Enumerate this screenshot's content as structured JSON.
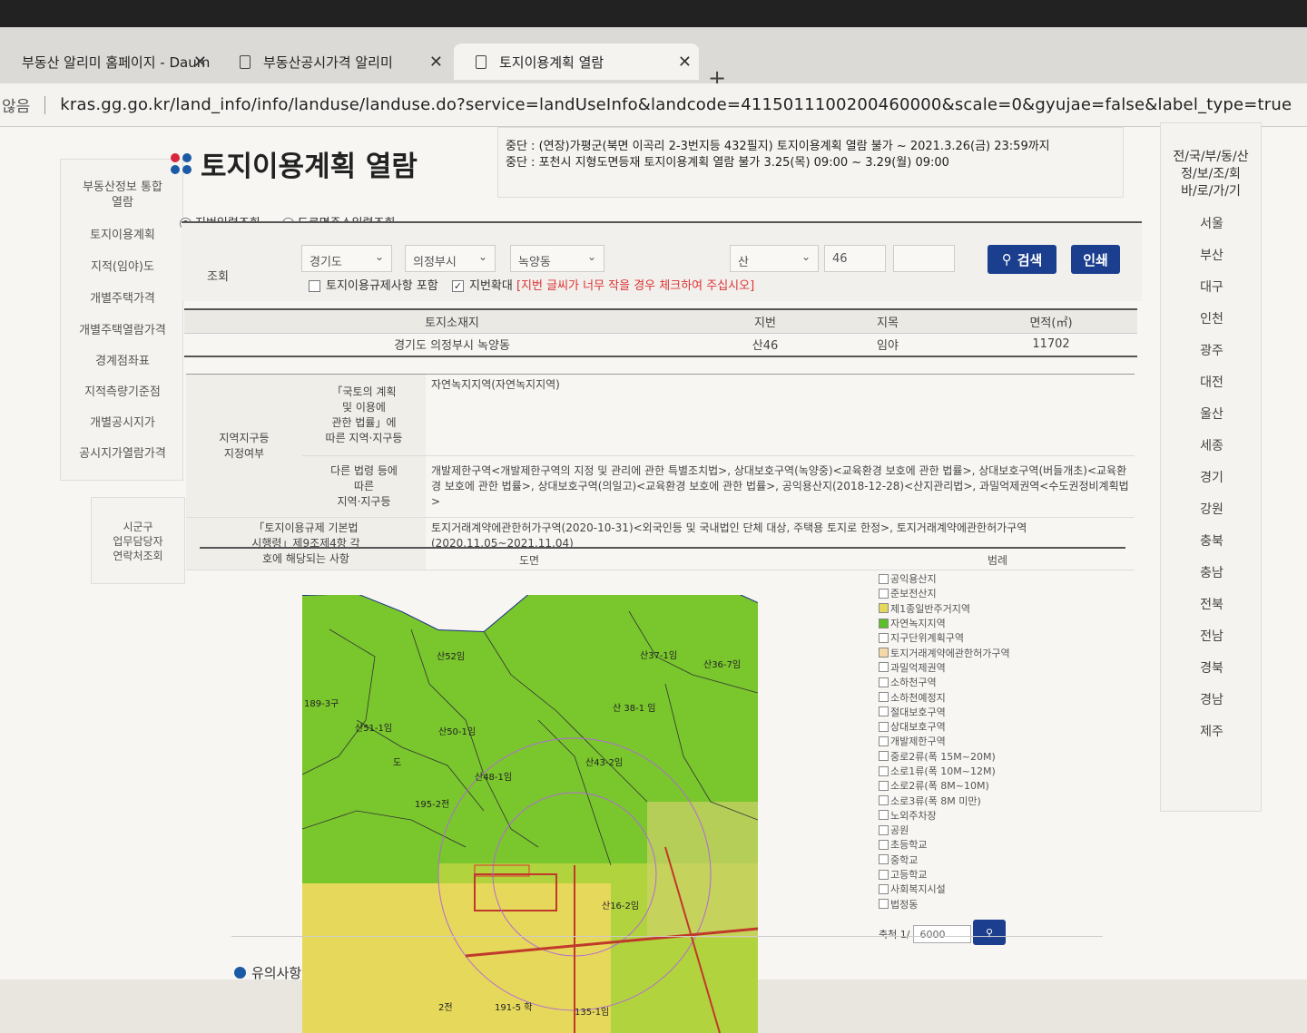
{
  "browser": {
    "tabs": [
      {
        "label": "부동산 알리미 홈페이지 - Daum"
      },
      {
        "label": "부동산공시가격 알리미"
      },
      {
        "label": "토지이용계획 열람"
      }
    ],
    "security": "않음",
    "url": "kras.gg.go.kr/land_info/info/landuse/landuse.do?service=landUseInfo&landcode=4115011100200460000&scale=0&gyujae=false&label_type=true"
  },
  "left_nav": {
    "items": [
      "부동산정보 통합\n열람",
      "토지이용계획",
      "지적(임야)도",
      "개별주택가격",
      "개별주택열람가격",
      "경계점좌표",
      "지적측량기준점",
      "개별공시지가",
      "공시지가열람가격"
    ],
    "contact": "시군구\n업무담당자\n연락처조회"
  },
  "page": {
    "title": "토지이용계획 열람",
    "notice_1": "중단 : (연장)가평군(북면 이곡리 2-3번지등 432필지) 토지이용계획 열람 불가 ~ 2021.3.26(금) 23:59까지",
    "notice_2": "중단 : 포천시 지형도면등재 토지이용계획 열람 불가 3.25(목) 09:00 ~ 3.29(월) 09:00"
  },
  "search": {
    "radio_lot": "지번입력조회",
    "radio_road": "도로명주소입력조회",
    "label": "조회",
    "sido": "경기도",
    "sigungu": "의정부시",
    "dong": "녹양동",
    "san": "산",
    "bonbun": "46",
    "bubun": "",
    "include_regulation": "토지이용규제사항 포함",
    "enlarge": "지번확대",
    "enlarge_note": "[지번 글씨가 너무 작을 경우 체크하여 주십시오]",
    "search_button": "검색",
    "print_button": "인쇄"
  },
  "land_info": {
    "headers": [
      "토지소재지",
      "지번",
      "지목",
      "면적(㎡)"
    ],
    "row": [
      "경기도 의정부시 녹양동",
      "산46",
      "임야",
      "11702"
    ]
  },
  "zones": {
    "group_label": "지역지구등\n지정여부",
    "law1_label": "「국토의 계획\n및 이용에\n관한 법률」에\n따른 지역·지구등",
    "law1_value": "자연녹지지역(자연녹지지역)",
    "law2_label": "다른 법령 등에\n따른\n지역·지구등",
    "law2_value": "개발제한구역<개발제한구역의 지정 및 관리에 관한 특별조치법>, 상대보호구역(녹양중)<교육환경 보호에 관한 법률>, 상대보호구역(버들개초)<교육환경 보호에 관한 법률>, 상대보호구역(의일고)<교육환경 보호에 관한 법률>, 공익용산지(2018-12-28)<산지관리법>, 과밀억제권역<수도권정비계획법>",
    "reg_label": "「토지이용규제 기본법\n시행령」제9조제4항 각\n호에 해당되는 사항",
    "reg_value": "토지거래계약에관한허가구역(2020-10-31)<외국인등 및 국내법인 단체 대상, 주택용 토지로 한정>, 토지거래계약에관한허가구역\n(2020.11.05~2021.11.04)"
  },
  "map": {
    "col_map": "도면",
    "col_legend": "범례",
    "parcel_labels": [
      "산52임",
      "산51-1임",
      "산50-1임",
      "산 38-1 임",
      "산48-1임",
      "산43-2임",
      "산36-7임",
      "195-2전",
      "산37-1임",
      "191-5 학",
      "산16-2임",
      "135-1임",
      "189-3구",
      "2전",
      "도"
    ],
    "legend": [
      {
        "label": "공익용산지",
        "color": "#ffffff"
      },
      {
        "label": "준보전산지",
        "color": "#ffffff"
      },
      {
        "label": "제1종일반주거지역",
        "color": "#e6d85a"
      },
      {
        "label": "자연녹지지역",
        "color": "#5cbf2a"
      },
      {
        "label": "지구단위계획구역",
        "color": "#ffffff"
      },
      {
        "label": "토지거래계약에관한허가구역",
        "color": "#f6d9a8"
      },
      {
        "label": "과밀억제권역",
        "color": "#ffffff"
      },
      {
        "label": "소하천구역",
        "color": "#ffffff"
      },
      {
        "label": "소하천예정지",
        "color": "#ffffff"
      },
      {
        "label": "절대보호구역",
        "color": "#ffffff"
      },
      {
        "label": "상대보호구역",
        "color": "#ffffff"
      },
      {
        "label": "개발제한구역",
        "color": "#ffffff"
      },
      {
        "label": "중로2류(폭 15M~20M)",
        "color": "#ffffff"
      },
      {
        "label": "소로1류(폭 10M~12M)",
        "color": "#ffffff"
      },
      {
        "label": "소로2류(폭 8M~10M)",
        "color": "#ffffff"
      },
      {
        "label": "소로3류(폭 8M 미만)",
        "color": "#ffffff"
      },
      {
        "label": "노외주차장",
        "color": "#ffffff"
      },
      {
        "label": "공원",
        "color": "#ffffff"
      },
      {
        "label": "초등학교",
        "color": "#ffffff"
      },
      {
        "label": "중학교",
        "color": "#ffffff"
      },
      {
        "label": "고등학교",
        "color": "#ffffff"
      },
      {
        "label": "사회복지시설",
        "color": "#ffffff"
      },
      {
        "label": "법정동",
        "color": "#ffffff"
      }
    ],
    "scale_label": "축척 1/",
    "scale_value": "6000"
  },
  "notes": {
    "label": "유의사항"
  },
  "right_nav": {
    "header": "전/국/부/동/산\n정/보/조/회\n바/로/가/기",
    "regions": [
      "서울",
      "부산",
      "대구",
      "인천",
      "광주",
      "대전",
      "울산",
      "세종",
      "경기",
      "강원",
      "충북",
      "충남",
      "전북",
      "전남",
      "경북",
      "경남",
      "제주"
    ]
  },
  "colors": {
    "primary_button": "#1c3e8e",
    "map_green": "#79c62d",
    "map_yellow": "#e6d85a"
  }
}
